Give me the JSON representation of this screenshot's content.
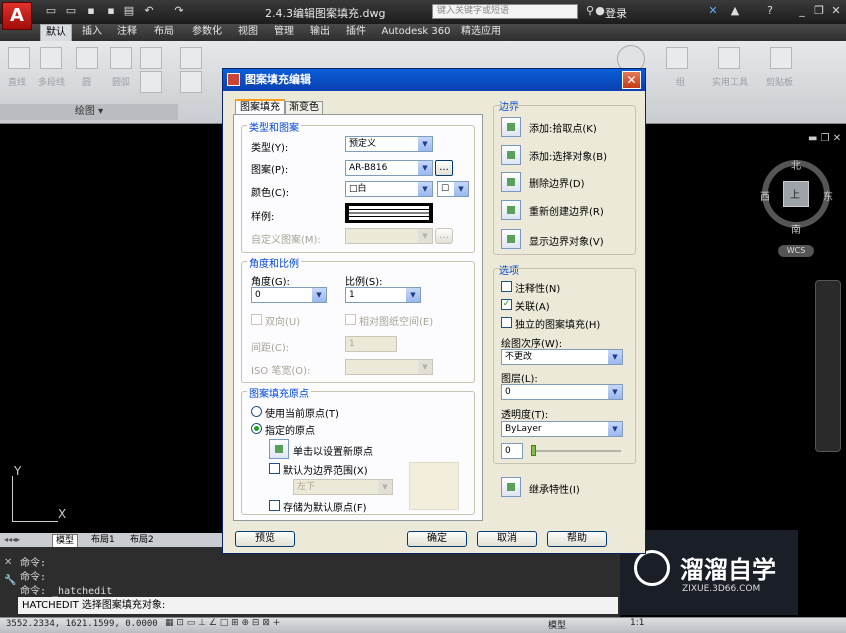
{
  "window": {
    "title": "2.4.3编辑图案填充.dwg",
    "app_letter": "A",
    "search_placeholder": "键入关键字或短语",
    "login": "登录"
  },
  "tabs": [
    "默认",
    "插入",
    "注释",
    "布局",
    "参数化",
    "视图",
    "管理",
    "输出",
    "插件",
    "Autodesk 360",
    "精选应用"
  ],
  "ribbon": {
    "draw_tools": [
      "直线",
      "多段线",
      "圆",
      "圆弧"
    ],
    "panel_title": "绘图 ▾",
    "right_tools": [
      "组",
      "实用工具",
      "剪贴板"
    ]
  },
  "compass": {
    "north": "北",
    "south": "南",
    "east": "东",
    "west": "西",
    "center": "上",
    "wcs": "WCS"
  },
  "axis": {
    "y": "Y",
    "x": "X"
  },
  "layout_tabs": [
    "模型",
    "布局1",
    "布局2"
  ],
  "command": {
    "history": [
      "命令:",
      "命令:",
      "命令:  _hatchedit"
    ],
    "input": "HATCHEDIT 选择图案填充对象:"
  },
  "status": {
    "coords": "3552.2334, 1621.1599, 0.0000",
    "model": "模型",
    "scale": "1:1"
  },
  "watermark": {
    "brand": "溜溜自学",
    "url": "ZIXUE.3D66.COM"
  },
  "dialog": {
    "title": "图案填充编辑",
    "tabs": [
      "图案填充",
      "渐变色"
    ],
    "type_group": {
      "title": "类型和图案",
      "type_label": "类型(Y):",
      "type_value": "预定义",
      "pattern_label": "图案(P):",
      "pattern_value": "AR-B816",
      "browse": "...",
      "color_label": "颜色(C):",
      "color_value": "□白",
      "bg_value": "☐",
      "sample_label": "样例:",
      "custom_label": "自定义图案(M):",
      "custom_value": ""
    },
    "angle_group": {
      "title": "角度和比例",
      "angle_label": "角度(G):",
      "angle_value": "0",
      "scale_label": "比例(S):",
      "scale_value": "1",
      "double_label": "双向(U)",
      "relative_label": "相对图纸空间(E)",
      "spacing_label": "间距(C):",
      "spacing_value": "1",
      "iso_label": "ISO 笔宽(O):",
      "iso_value": ""
    },
    "origin_group": {
      "title": "图案填充原点",
      "use_current": "使用当前原点(T)",
      "specified": "指定的原点",
      "click_set": "单击以设置新原点",
      "default_extent": "默认为边界范围(X)",
      "extent_value": "左下",
      "store_default": "存储为默认原点(F)"
    },
    "boundary": {
      "title": "边界",
      "add_pick": "添加:拾取点(K)",
      "add_select": "添加:选择对象(B)",
      "remove": "删除边界(D)",
      "recreate": "重新创建边界(R)",
      "show": "显示边界对象(V)"
    },
    "options": {
      "title": "选项",
      "annotative": "注释性(N)",
      "associative": "关联(A)",
      "separate": "独立的图案填充(H)",
      "draw_order_label": "绘图次序(W):",
      "draw_order_value": "不更改",
      "layer_label": "图层(L):",
      "layer_value": "0",
      "transparency_label": "透明度(T):",
      "transparency_value": "ByLayer",
      "transparency_num": "0"
    },
    "inherit": "继承特性(I)",
    "buttons": {
      "preview": "预览",
      "ok": "确定",
      "cancel": "取消",
      "help": "帮助"
    }
  }
}
